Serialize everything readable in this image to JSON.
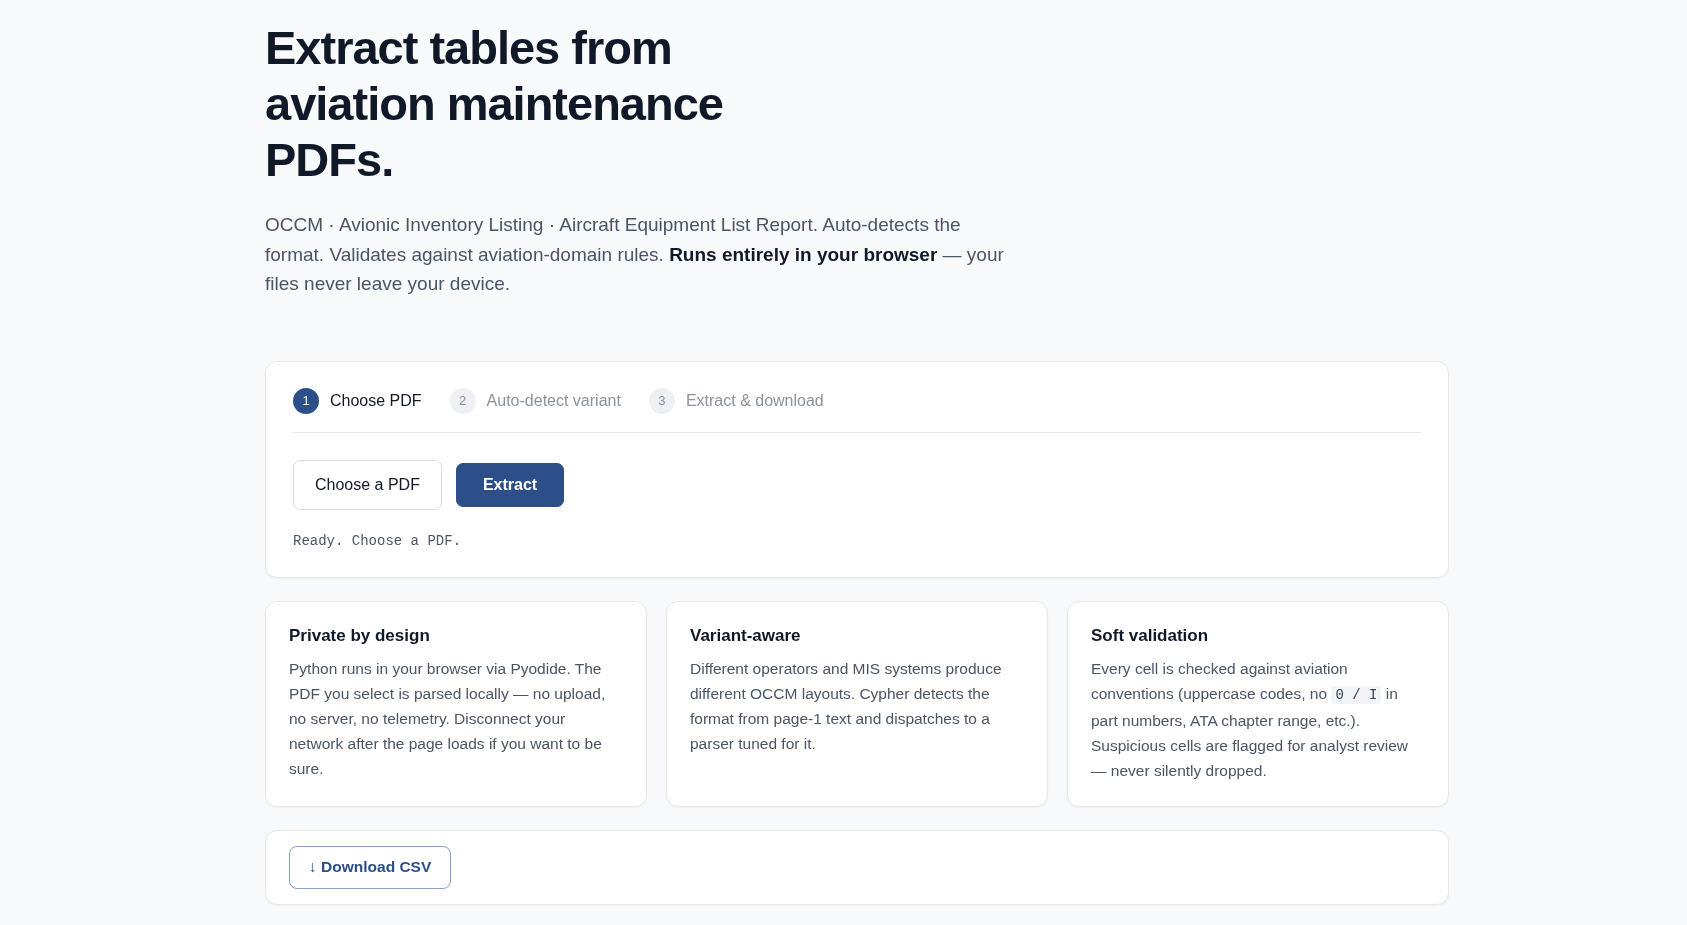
{
  "hero": {
    "title": "Extract tables from aviation maintenance PDFs.",
    "description": "OCCM · Avionic Inventory Listing · Aircraft Equipment List Report. Auto-detects the format. Validates against aviation-domain rules. **Runs entirely in your browser** — your files never leave your device."
  },
  "steps": [
    {
      "number": "1",
      "label": "Choose PDF",
      "selected": true
    },
    {
      "number": "2",
      "label": "Auto-detect variant",
      "selected": false
    },
    {
      "number": "3",
      "label": "Extract & download",
      "selected": false
    }
  ],
  "actions": [
    {
      "label": "Choose a PDF",
      "kind": "secondary"
    },
    {
      "label": "Extract",
      "kind": "primary"
    }
  ],
  "status": "Ready. Choose a PDF.",
  "features": [
    {
      "title": "Private by design",
      "body": [
        {
          "kind": "text",
          "text": "Python runs in your browser via Pyodide. The PDF you select is parsed locally — no upload, no server, no telemetry. Disconnect your network after the page loads if you want to be sure."
        }
      ]
    },
    {
      "title": "Variant-aware",
      "body": [
        {
          "kind": "text",
          "text": "Different operators and MIS systems produce different OCCM layouts. Cypher detects the format from page-1 text and dispatches to a parser tuned for it."
        }
      ]
    },
    {
      "title": "Soft validation",
      "body": [
        {
          "kind": "text",
          "text": "Every cell is checked against aviation conventions (uppercase codes, no "
        },
        {
          "kind": "code",
          "text": "0 / I"
        },
        {
          "kind": "text",
          "text": " in part numbers, ATA chapter range, etc.). Suspicious cells are flagged for analyst review — never silently dropped."
        }
      ]
    }
  ],
  "download": {
    "label": "↓ Download CSV"
  }
}
